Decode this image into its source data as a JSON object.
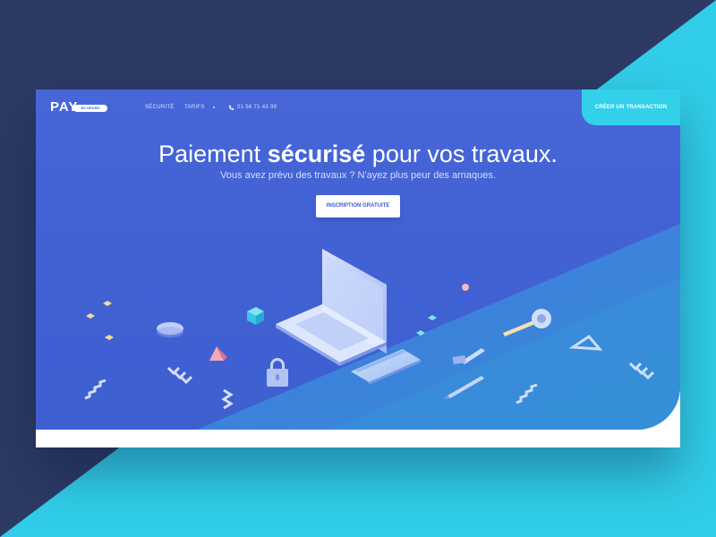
{
  "colors": {
    "page_background": "#2c3a64",
    "accent_cyan": "#33d0ea",
    "hero_blue": "#4767d8",
    "card_white": "#ffffff"
  },
  "nav": {
    "logo": "PAY",
    "logo_badge": "BY HEARD",
    "links": [
      "SÉCURITÉ",
      "TARIFS"
    ],
    "phone_icon": "phone-icon",
    "phone": "01 56 71 43 99",
    "cta": "CRÉER UN TRANSACTION"
  },
  "hero": {
    "headline_before": "Paiement",
    "headline_bold": "sécurisé",
    "headline_after": "pour vos travaux.",
    "subheadline": "Vous avez prévu des travaux ? N'ayez plus peur des arnaques.",
    "button": "INSCRIPTION GRATUITE"
  },
  "illustration": {
    "items": [
      "laptop-icon",
      "credit-card-icon",
      "padlock-icon",
      "mouse-icon",
      "cube-icon",
      "pyramid-icon",
      "hammer-icon",
      "pencil-icon",
      "tape-measure-icon",
      "set-square-icon",
      "chevron-arrows-icon",
      "zigzag-icon",
      "stairs-icon"
    ]
  }
}
